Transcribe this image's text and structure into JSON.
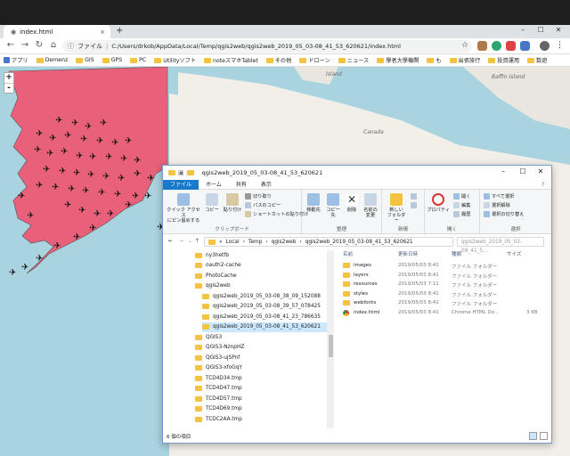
{
  "browser": {
    "tab_title": "index.html",
    "tab_close": "×",
    "new_tab": "+",
    "window_min": "–",
    "window_max": "☐",
    "window_close": "✕",
    "back_icon": "←",
    "forward_icon": "→",
    "reload_icon": "↻",
    "file_label": "ファイル",
    "url": "C:/Users/drkob/AppData/Local/Temp/qgis2web/qgis2web_2019_05_03-08_41_53_620621/index.html",
    "star_icon": "☆"
  },
  "bookmarks": [
    "アプリ",
    "Demenz",
    "GIS",
    "GPS",
    "PC",
    "Utilityソフト",
    "noteスマホTablet",
    "その他",
    "ドローン",
    "ニュース",
    "學者大學機関",
    "も",
    "出張旅行",
    "投資運用",
    "数遊"
  ],
  "map": {
    "zoom_in": "+",
    "zoom_out": "-",
    "labels": {
      "island": "Island",
      "baffin": "Baffin Island",
      "canada": "Canada"
    },
    "plane_glyph": "✈"
  },
  "explorer": {
    "title": "qgis2web_2019_05_03-08_41_53_620621",
    "min": "–",
    "max": "☐",
    "close": "✕",
    "ribbon_tabs": [
      "ファイル",
      "ホーム",
      "共有",
      "表示"
    ],
    "ribbon": {
      "pin_quick": "クイック アクセス\nにピン留めする",
      "copy": "コピー",
      "paste": "貼り付け",
      "cut": "切り取り",
      "copy_path": "パスのコピー",
      "paste_shortcut": "ショートカットの貼り付け",
      "group_clipboard": "クリップボード",
      "move_to": "移動先",
      "copy_to": "コピー先",
      "delete": "削除",
      "rename": "名前の\n変更",
      "group_organize": "整理",
      "new_folder": "新しい\nフォルダー",
      "group_new": "新規",
      "properties": "プロパティ",
      "open": "開く",
      "edit": "編集",
      "history": "履歴",
      "group_open": "開く",
      "select_all": "すべて選択",
      "select_none": "選択解除",
      "invert_selection": "選択の切り替え",
      "group_select": "選択"
    },
    "path": [
      "Local",
      "Temp",
      "qgis2web",
      "qgis2web_2019_05_03-08_41_53_620621"
    ],
    "search_placeholder": "qgis2web_2019_05_03-08_41_5...",
    "nav_items": [
      {
        "label": "ny3hetfb",
        "indent": 0,
        "selected": false
      },
      {
        "label": "oauth2-cache",
        "indent": 0,
        "selected": false
      },
      {
        "label": "PhotoCache",
        "indent": 0,
        "selected": false
      },
      {
        "label": "qgis2web",
        "indent": 0,
        "selected": false
      },
      {
        "label": "qgis2web_2019_05_03-08_38_09_152088",
        "indent": 1,
        "selected": false
      },
      {
        "label": "qgis2web_2019_05_03-08_39_57_078425",
        "indent": 1,
        "selected": false
      },
      {
        "label": "qgis2web_2019_05_03-08_41_23_786635",
        "indent": 1,
        "selected": false
      },
      {
        "label": "qgis2web_2019_05_03-08_41_53_620621",
        "indent": 1,
        "selected": true
      },
      {
        "label": "QGIS3",
        "indent": 0,
        "selected": false
      },
      {
        "label": "QGIS3-NznpHZ",
        "indent": 0,
        "selected": false
      },
      {
        "label": "QGIS3-ujSPnf",
        "indent": 0,
        "selected": false
      },
      {
        "label": "QGIS3-xfoGqY",
        "indent": 0,
        "selected": false
      },
      {
        "label": "TCD4D34.tmp",
        "indent": 0,
        "selected": false
      },
      {
        "label": "TCD4D47.tmp",
        "indent": 0,
        "selected": false
      },
      {
        "label": "TCD4D57.tmp",
        "indent": 0,
        "selected": false
      },
      {
        "label": "TCD4D69.tmp",
        "indent": 0,
        "selected": false
      },
      {
        "label": "TCDC2AA.tmp",
        "indent": 0,
        "selected": false
      }
    ],
    "columns": [
      "名前",
      "更新日時",
      "種類",
      "サイズ"
    ],
    "files": [
      {
        "name": "images",
        "date": "2019/05/03 8:41",
        "type": "ファイル フォルダー",
        "size": "",
        "kind": "folder"
      },
      {
        "name": "layers",
        "date": "2019/05/03 8:41",
        "type": "ファイル フォルダー",
        "size": "",
        "kind": "folder"
      },
      {
        "name": "resources",
        "date": "2019/05/03 7:11",
        "type": "ファイル フォルダー",
        "size": "",
        "kind": "folder"
      },
      {
        "name": "styles",
        "date": "2019/05/03 8:41",
        "type": "ファイル フォルダー",
        "size": "",
        "kind": "folder"
      },
      {
        "name": "webfonts",
        "date": "2019/05/03 8:41",
        "type": "ファイル フォルダー",
        "size": "",
        "kind": "folder"
      },
      {
        "name": "index.html",
        "date": "2019/05/03 8:41",
        "type": "Chrome HTML Do...",
        "size": "3 KB",
        "kind": "chrome"
      }
    ],
    "status": "6 個の項目"
  },
  "colors": {
    "alaska": "#e8607a",
    "ocean": "#a9d3df",
    "accent": "#1979ca"
  }
}
